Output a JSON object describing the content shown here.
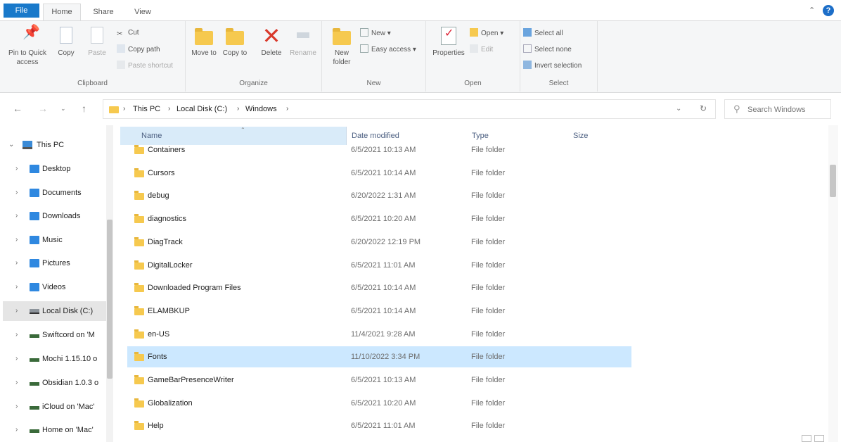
{
  "ribbon_tabs": [
    "File",
    "Home",
    "Share",
    "View"
  ],
  "help_label": "?",
  "ribbon": {
    "clipboard": {
      "title": "Clipboard",
      "pin": "Pin to Quick access",
      "copy": "Copy",
      "paste": "Paste",
      "cut": "Cut",
      "copy_path": "Copy path",
      "paste_shortcut": "Paste shortcut"
    },
    "organize": {
      "title": "Organize",
      "move_to": "Move to",
      "copy_to": "Copy to",
      "delete": "Delete",
      "rename": "Rename"
    },
    "new": {
      "title": "New",
      "new_folder": "New folder",
      "new_item": "New",
      "easy_access": "Easy access"
    },
    "open": {
      "title": "Open",
      "properties": "Properties",
      "open": "Open",
      "edit": "Edit"
    },
    "select": {
      "title": "Select",
      "select_all": "Select all",
      "select_none": "Select none",
      "invert_selection": "Invert selection"
    }
  },
  "address": {
    "crumbs": [
      "This PC",
      "Local Disk (C:)",
      "Windows"
    ],
    "search_placeholder": "Search Windows"
  },
  "nav": {
    "items": [
      {
        "label": "This PC",
        "icon": "pc-icon",
        "expanded": true
      },
      {
        "label": "Desktop",
        "icon": "folder-icon"
      },
      {
        "label": "Documents",
        "icon": "folder-icon"
      },
      {
        "label": "Downloads",
        "icon": "folder-icon"
      },
      {
        "label": "Music",
        "icon": "folder-icon"
      },
      {
        "label": "Pictures",
        "icon": "folder-icon"
      },
      {
        "label": "Videos",
        "icon": "folder-icon"
      },
      {
        "label": "Local Disk (C:)",
        "icon": "disk-icon",
        "selected": true
      },
      {
        "label": "Swiftcord on 'M",
        "icon": "network-drive-icon"
      },
      {
        "label": "Mochi 1.15.10 o",
        "icon": "network-drive-icon"
      },
      {
        "label": "Obsidian 1.0.3 o",
        "icon": "network-drive-icon"
      },
      {
        "label": "iCloud on 'Mac'",
        "icon": "network-drive-icon"
      },
      {
        "label": "Home on 'Mac'",
        "icon": "network-drive-icon"
      }
    ]
  },
  "columns": {
    "name": "Name",
    "date": "Date modified",
    "type": "Type",
    "size": "Size"
  },
  "files": [
    {
      "name": "Containers",
      "date": "6/5/2021 10:13 AM",
      "type": "File folder"
    },
    {
      "name": "Cursors",
      "date": "6/5/2021 10:14 AM",
      "type": "File folder"
    },
    {
      "name": "debug",
      "date": "6/20/2022 1:31 AM",
      "type": "File folder"
    },
    {
      "name": "diagnostics",
      "date": "6/5/2021 10:20 AM",
      "type": "File folder"
    },
    {
      "name": "DiagTrack",
      "date": "6/20/2022 12:19 PM",
      "type": "File folder"
    },
    {
      "name": "DigitalLocker",
      "date": "6/5/2021 11:01 AM",
      "type": "File folder"
    },
    {
      "name": "Downloaded Program Files",
      "date": "6/5/2021 10:14 AM",
      "type": "File folder"
    },
    {
      "name": "ELAMBKUP",
      "date": "6/5/2021 10:14 AM",
      "type": "File folder"
    },
    {
      "name": "en-US",
      "date": "11/4/2021 9:28 AM",
      "type": "File folder"
    },
    {
      "name": "Fonts",
      "date": "11/10/2022 3:34 PM",
      "type": "File folder",
      "selected": true
    },
    {
      "name": "GameBarPresenceWriter",
      "date": "6/5/2021 10:13 AM",
      "type": "File folder"
    },
    {
      "name": "Globalization",
      "date": "6/5/2021 10:20 AM",
      "type": "File folder"
    },
    {
      "name": "Help",
      "date": "6/5/2021 11:01 AM",
      "type": "File folder"
    }
  ],
  "colors": {
    "accent": "#1979ca",
    "selection": "#cce8ff",
    "folder": "#f6c94f"
  }
}
